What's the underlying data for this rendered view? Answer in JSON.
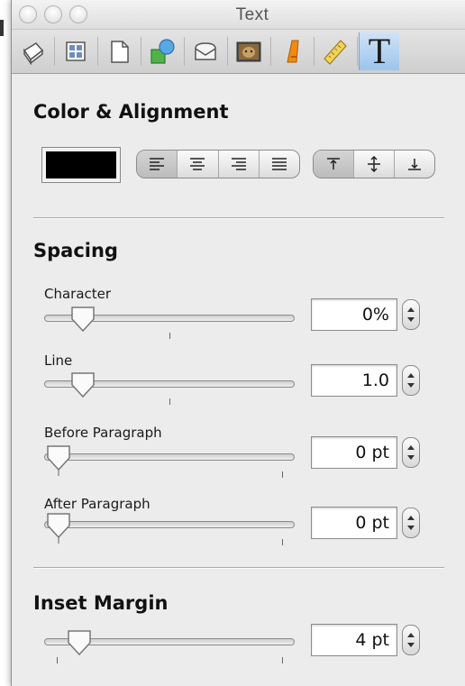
{
  "window": {
    "title": "Text"
  },
  "toolbar": {
    "tabs": [
      {
        "icon": "document-inspector-icon"
      },
      {
        "icon": "layout-inspector-icon"
      },
      {
        "icon": "page-inspector-icon"
      },
      {
        "icon": "shape-inspector-icon"
      },
      {
        "icon": "comment-inspector-icon"
      },
      {
        "icon": "image-inspector-icon"
      },
      {
        "icon": "font-inspector-icon"
      },
      {
        "icon": "metrics-inspector-icon"
      },
      {
        "icon": "text-inspector-icon",
        "glyph": "T",
        "active": true
      }
    ]
  },
  "color_alignment": {
    "title": "Color & Alignment",
    "text_color": "#000000",
    "horizontal_alignment": [
      "left",
      "center",
      "right",
      "justify"
    ],
    "horizontal_selected": "left",
    "vertical_alignment": [
      "top",
      "middle",
      "bottom"
    ],
    "vertical_selected": "top"
  },
  "spacing": {
    "title": "Spacing",
    "character": {
      "label": "Character",
      "value": "0%",
      "level": 0.2
    },
    "line": {
      "label": "Line",
      "value": "1.0",
      "level": 0.2
    },
    "before_paragraph": {
      "label": "Before Paragraph",
      "value": "0 pt",
      "level": 0.0
    },
    "after_paragraph": {
      "label": "After Paragraph",
      "value": "0 pt",
      "level": 0.0
    }
  },
  "inset_margin": {
    "title": "Inset Margin",
    "value": "4 pt",
    "level": 0.14
  }
}
